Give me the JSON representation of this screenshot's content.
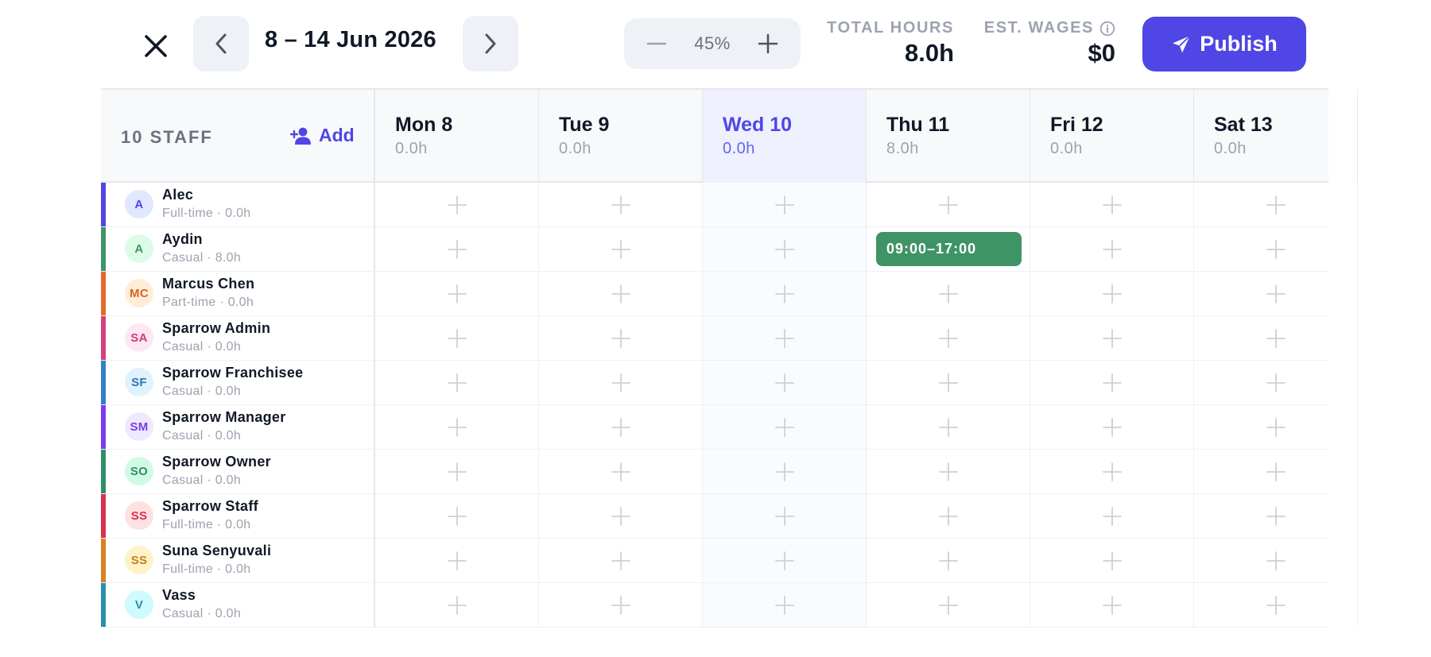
{
  "toolbar": {
    "close_icon": "close-icon",
    "prev_icon": "chevron-left-icon",
    "next_icon": "chevron-right-icon",
    "week_label": "8 – 14 Jun 2026",
    "zoom_value": "45%",
    "total_hours_label": "TOTAL HOURS",
    "total_hours_value": "8.0h",
    "est_wages_label": "EST. WAGES",
    "est_wages_value": "$0",
    "publish_label": "Publish"
  },
  "staff_header": {
    "count_label": "10 STAFF",
    "add_label": "Add"
  },
  "days": [
    {
      "label": "Mon 8",
      "hours": "0.0h",
      "today": false
    },
    {
      "label": "Tue 9",
      "hours": "0.0h",
      "today": false
    },
    {
      "label": "Wed 10",
      "hours": "0.0h",
      "today": true
    },
    {
      "label": "Thu 11",
      "hours": "8.0h",
      "today": false
    },
    {
      "label": "Fri 12",
      "hours": "0.0h",
      "today": false
    },
    {
      "label": "Sat 13",
      "hours": "0.0h",
      "today": false
    }
  ],
  "staff": [
    {
      "name": "Alec",
      "meta": "Full-time · 0.0h",
      "initials": "A",
      "color": "#4f46e5",
      "avatar_bg": "#e0e7ff",
      "avatar_fg": "#4f46e5",
      "shifts": {}
    },
    {
      "name": "Aydin",
      "meta": "Casual · 8.0h",
      "initials": "A",
      "color": "#3f9466",
      "avatar_bg": "#dcfce7",
      "avatar_fg": "#3f9466",
      "shifts": {
        "3": "09:00–17:00"
      }
    },
    {
      "name": "Marcus Chen",
      "meta": "Part-time · 0.0h",
      "initials": "MC",
      "color": "#e36a2c",
      "avatar_bg": "#ffedd5",
      "avatar_fg": "#d9622b",
      "shifts": {}
    },
    {
      "name": "Sparrow Admin",
      "meta": "Casual · 0.0h",
      "initials": "SA",
      "color": "#d63f7e",
      "avatar_bg": "#fce7f3",
      "avatar_fg": "#cf3a78",
      "shifts": {}
    },
    {
      "name": "Sparrow Franchisee",
      "meta": "Casual · 0.0h",
      "initials": "SF",
      "color": "#2f80c4",
      "avatar_bg": "#e0f2fe",
      "avatar_fg": "#2f74b5",
      "shifts": {}
    },
    {
      "name": "Sparrow Manager",
      "meta": "Casual · 0.0h",
      "initials": "SM",
      "color": "#7c3aed",
      "avatar_bg": "#ede9fe",
      "avatar_fg": "#7c3aed",
      "shifts": {}
    },
    {
      "name": "Sparrow Owner",
      "meta": "Casual · 0.0h",
      "initials": "SO",
      "color": "#2f8f6a",
      "avatar_bg": "#d1fae5",
      "avatar_fg": "#2f8f6a",
      "shifts": {}
    },
    {
      "name": "Sparrow Staff",
      "meta": "Full-time · 0.0h",
      "initials": "SS",
      "color": "#dc2f4f",
      "avatar_bg": "#fee2e2",
      "avatar_fg": "#dc2f4f",
      "shifts": {}
    },
    {
      "name": "Suna Senyuvali",
      "meta": "Full-time · 0.0h",
      "initials": "SS",
      "color": "#d9821f",
      "avatar_bg": "#fef3c7",
      "avatar_fg": "#c97a1c",
      "shifts": {}
    },
    {
      "name": "Vass",
      "meta": "Casual · 0.0h",
      "initials": "V",
      "color": "#2a90a8",
      "avatar_bg": "#cffafe",
      "avatar_fg": "#2a90a8",
      "shifts": {}
    }
  ]
}
